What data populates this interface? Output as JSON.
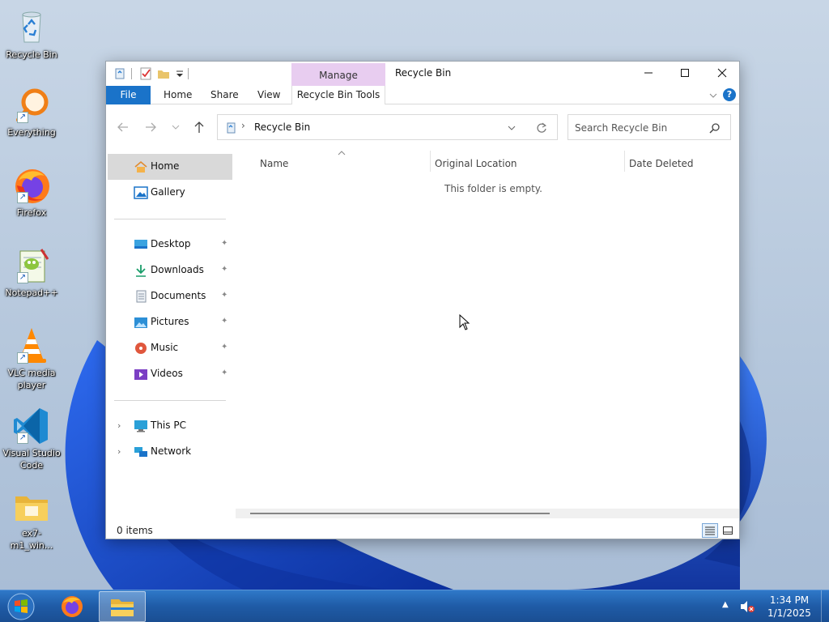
{
  "desktop": {
    "icons": [
      {
        "label": "Recycle Bin",
        "icon": "recycle-bin-icon"
      },
      {
        "label": "Everything",
        "icon": "everything-search-icon"
      },
      {
        "label": "Firefox",
        "icon": "firefox-icon"
      },
      {
        "label": "Notepad++",
        "icon": "notepad-plus-plus-icon"
      },
      {
        "label": "VLC media player",
        "icon": "vlc-icon"
      },
      {
        "label": "Visual Studio Code",
        "icon": "vscode-icon"
      },
      {
        "label": "ex7-m1_win...",
        "icon": "folder-icon"
      }
    ]
  },
  "window": {
    "title": "Recycle Bin",
    "contextual_tab_group": "Manage",
    "ribbon_tabs": {
      "file": "File",
      "home": "Home",
      "share": "Share",
      "view": "View",
      "recycle_bin_tools": "Recycle Bin Tools"
    },
    "address": {
      "path": "Recycle Bin"
    },
    "search": {
      "placeholder": "Search Recycle Bin"
    },
    "nav_pane": {
      "home": "Home",
      "gallery": "Gallery",
      "desktop": "Desktop",
      "downloads": "Downloads",
      "documents": "Documents",
      "pictures": "Pictures",
      "music": "Music",
      "videos": "Videos",
      "this_pc": "This PC",
      "network": "Network"
    },
    "columns": {
      "name": "Name",
      "original_location": "Original Location",
      "date_deleted": "Date Deleted"
    },
    "empty_message": "This folder is empty.",
    "status": {
      "items": "0 items"
    }
  },
  "taskbar": {
    "time": "1:34 PM",
    "date": "1/1/2025"
  },
  "colors": {
    "accent": "#1a73c9",
    "manage_tab": "#e8cdf0",
    "taskbar": "#1f5ba6",
    "nav_selected": "#d9d9d9"
  }
}
